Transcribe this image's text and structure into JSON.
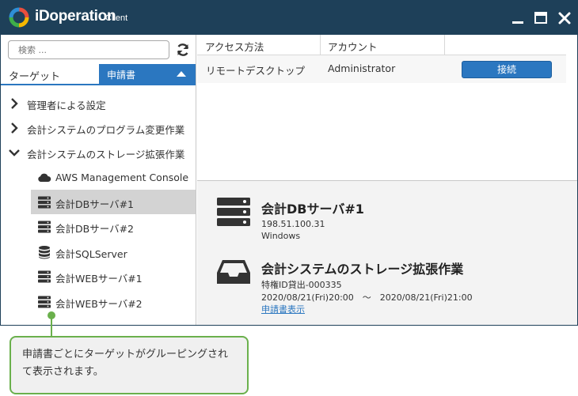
{
  "window": {
    "brand": "iDoperation",
    "brand_sub": "Client"
  },
  "left_panel": {
    "search_placeholder": "検索 ...",
    "target_label": "ターゲット",
    "form_tab_label": "申請書",
    "tree": [
      {
        "label": "管理者による設定",
        "type": "group",
        "expanded": false
      },
      {
        "label": "会計システムのプログラム変更作業",
        "type": "group",
        "expanded": false
      },
      {
        "label": "会計システムのストレージ拡張作業",
        "type": "group",
        "expanded": true
      },
      {
        "label": "AWS Management Console",
        "type": "cloud"
      },
      {
        "label": "会計DBサーバ#1",
        "type": "server",
        "selected": true
      },
      {
        "label": "会計DBサーバ#2",
        "type": "server"
      },
      {
        "label": "会計SQLServer",
        "type": "database"
      },
      {
        "label": "会計WEBサーバ#1",
        "type": "server"
      },
      {
        "label": "会計WEBサーバ#2",
        "type": "server"
      }
    ]
  },
  "access_table": {
    "headers": [
      "アクセス方法",
      "アカウント",
      ""
    ],
    "rows": [
      {
        "method": "リモートデスクトップ",
        "account": "Administrator",
        "action_label": "接続"
      }
    ]
  },
  "detail": {
    "server": {
      "title": "会計DBサーバ#1",
      "ip": "198.51.100.31",
      "os": "Windows"
    },
    "request": {
      "title": "会計システムのストレージ拡張作業",
      "privilege_id": "特権ID貸出-000335",
      "period": "2020/08/21(Fri)20:00　～　2020/08/21(Fri)21:00",
      "link_label": "申請書表示"
    }
  },
  "callout": {
    "text": "申請書ごとにターゲットがグルーピングされて表示されます。"
  },
  "colors": {
    "titlebar": "#1e4059",
    "accent": "#2b77c0",
    "callout_border": "#6ab04c",
    "selected_row": "#d3d3d3"
  }
}
